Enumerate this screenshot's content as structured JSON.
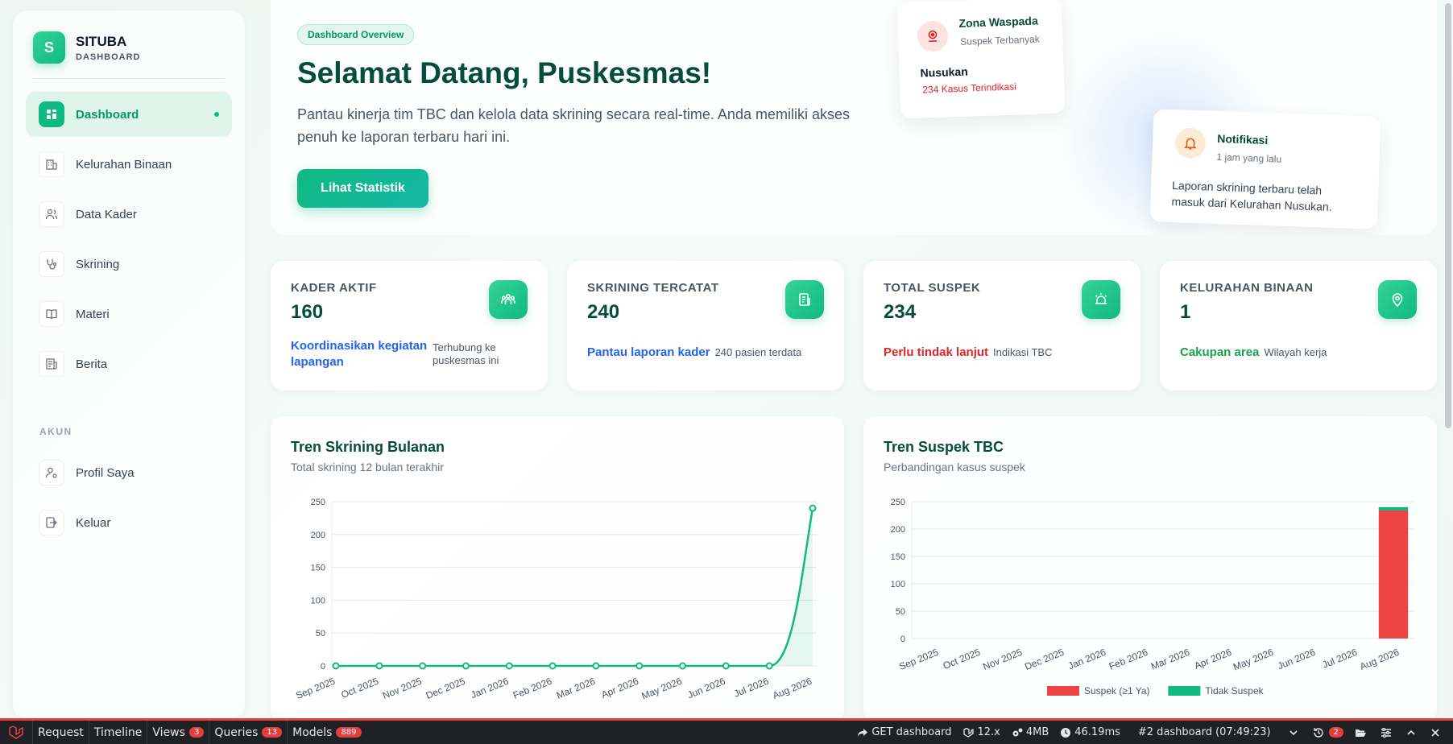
{
  "brand": {
    "logo_letter": "S",
    "name": "SITUBA",
    "subtitle": "DASHBOARD"
  },
  "sidebar": {
    "items": [
      {
        "label": "Dashboard",
        "icon": "dashboard-icon",
        "active": true
      },
      {
        "label": "Kelurahan Binaan",
        "icon": "building-icon"
      },
      {
        "label": "Data Kader",
        "icon": "users-icon"
      },
      {
        "label": "Skrining",
        "icon": "stethoscope-icon"
      },
      {
        "label": "Materi",
        "icon": "book-icon"
      },
      {
        "label": "Berita",
        "icon": "newspaper-icon"
      }
    ],
    "section_label": "AKUN",
    "account_items": [
      {
        "label": "Profil Saya",
        "icon": "user-cog-icon"
      },
      {
        "label": "Keluar",
        "icon": "logout-icon"
      }
    ]
  },
  "hero": {
    "badge": "Dashboard Overview",
    "title": "Selamat Datang, Puskesmas!",
    "description": "Pantau kinerja tim TBC dan kelola data skrining secara real-time. Anda memiliki akses penuh ke laporan terbaru hari ini.",
    "button": "Lihat Statistik"
  },
  "zona": {
    "title": "Zona Waspada",
    "subtitle": "Suspek Terbanyak",
    "name": "Nusukan",
    "count": "234 Kasus Terindikasi"
  },
  "notif": {
    "title": "Notifikasi",
    "time": "1 jam yang lalu",
    "body": "Laporan skrining terbaru telah masuk dari Kelurahan Nusukan."
  },
  "stats": [
    {
      "label": "KADER AKTIF",
      "value": "160",
      "link": "Koordinasikan kegiatan lapangan",
      "note": "Terhubung ke puskesmas ini",
      "color": "#2563eb",
      "icon": "team-icon"
    },
    {
      "label": "SKRINING TERCATAT",
      "value": "240",
      "link": "Pantau laporan kader",
      "note": "240 pasien terdata",
      "color": "#2563eb",
      "icon": "document-icon"
    },
    {
      "label": "TOTAL SUSPEK",
      "value": "234",
      "link": "Perlu tindak lanjut",
      "note": "Indikasi TBC",
      "color": "#dc2626",
      "icon": "alarm-icon"
    },
    {
      "label": "KELURAHAN BINAAN",
      "value": "1",
      "link": "Cakupan area",
      "note": "Wilayah kerja",
      "color": "#16a34a",
      "icon": "map-pin-icon"
    }
  ],
  "charts": {
    "line_title": "Tren Skrining Bulanan",
    "line_sub": "Total skrining 12 bulan terakhir",
    "bar_title": "Tren Suspek TBC",
    "bar_sub": "Perbandingan kasus suspek"
  },
  "chart_data": [
    {
      "type": "line",
      "title": "Tren Skrining Bulanan",
      "categories": [
        "Sep 2025",
        "Oct 2025",
        "Nov 2025",
        "Dec 2025",
        "Jan 2026",
        "Feb 2026",
        "Mar 2026",
        "Apr 2026",
        "May 2026",
        "Jun 2026",
        "Jul 2026",
        "Aug 2026"
      ],
      "values": [
        0,
        0,
        0,
        0,
        0,
        0,
        0,
        0,
        0,
        0,
        0,
        240
      ],
      "ylim": [
        0,
        250
      ],
      "yticks": [
        0,
        50,
        100,
        150,
        200,
        250
      ],
      "color": "#10b981",
      "grid": true
    },
    {
      "type": "bar",
      "title": "Tren Suspek TBC",
      "categories": [
        "Sep 2025",
        "Oct 2025",
        "Nov 2025",
        "Dec 2025",
        "Jan 2026",
        "Feb 2026",
        "Mar 2026",
        "Apr 2026",
        "May 2026",
        "Jun 2026",
        "Jul 2026",
        "Aug 2026"
      ],
      "series": [
        {
          "name": "Suspek (≥1 Ya)",
          "values": [
            0,
            0,
            0,
            0,
            0,
            0,
            0,
            0,
            0,
            0,
            0,
            234
          ],
          "color": "#ef4444"
        },
        {
          "name": "Tidak Suspek",
          "values": [
            0,
            0,
            0,
            0,
            0,
            0,
            0,
            0,
            0,
            0,
            0,
            6
          ],
          "color": "#10b981"
        }
      ],
      "stacked": true,
      "ylim": [
        0,
        250
      ],
      "yticks": [
        0,
        50,
        100,
        150,
        200,
        250
      ],
      "legend": "bottom",
      "grid": true
    }
  ],
  "debugbar": {
    "items": [
      {
        "label": "Request"
      },
      {
        "label": "Timeline"
      },
      {
        "label": "Views",
        "badge": "3"
      },
      {
        "label": "Queries",
        "badge": "13"
      },
      {
        "label": "Models",
        "badge": "889"
      }
    ],
    "route": "GET dashboard",
    "version": "12.x",
    "memory": "4MB",
    "time": "46.19ms",
    "request_id": "#2 dashboard (07:49:23)",
    "history_badge": "2"
  }
}
